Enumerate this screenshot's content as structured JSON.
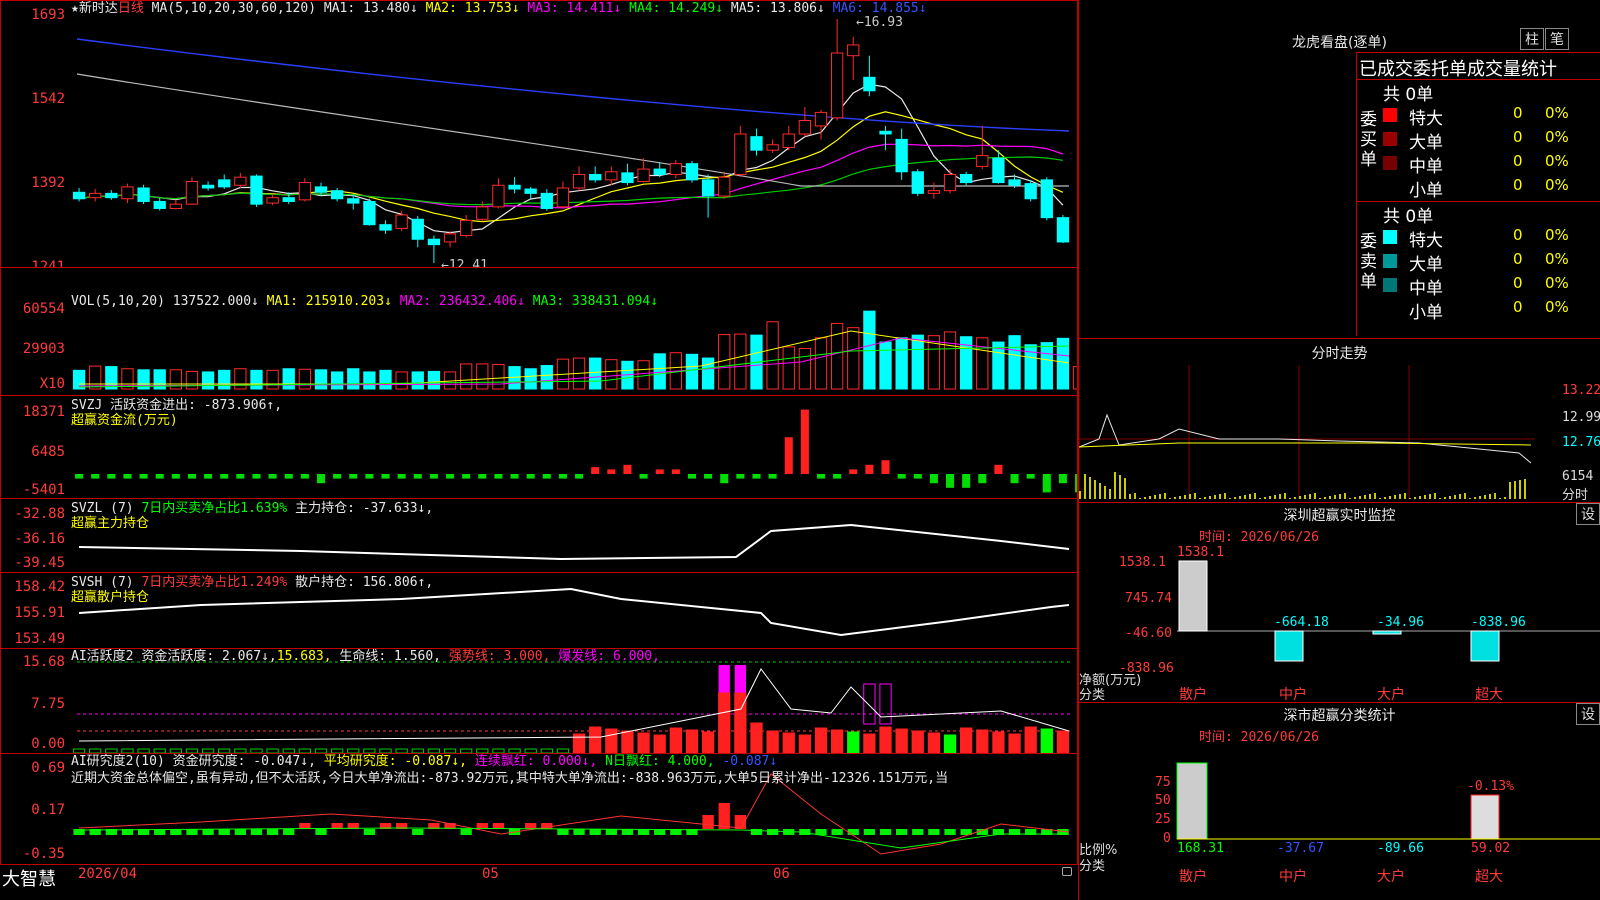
{
  "header": {
    "stock_name": "★新时达",
    "period": "日线",
    "ma_title": "MA(5,10,20,30,60,120)",
    "ma1": "MA1: 13.480↓",
    "ma2": "MA2: 13.753↓",
    "ma3": "MA3: 14.411↓",
    "ma4": "MA4: 14.249↓",
    "ma5": "MA5: 13.806↓",
    "ma6": "MA6: 14.855↓",
    "high_mark": "←16.93",
    "low_mark": "←12.41"
  },
  "price_axis": [
    "1693",
    "1542",
    "1392",
    "1241"
  ],
  "vol": {
    "title": "VOL(5,10,20)",
    "value": "137522.000↓",
    "ma1": "MA1: 215910.203↓",
    "ma2": "MA2: 236432.406↓",
    "ma3": "MA3: 338431.094↓",
    "axis": [
      "60554",
      "29903",
      "X10"
    ]
  },
  "svzj": {
    "line1_a": "SVZJ  活跃资金进出: ",
    "line1_b": "-873.906↑,",
    "line2": "超赢资金流(万元)",
    "axis": [
      "18371",
      "6485",
      "-5401"
    ]
  },
  "svzl": {
    "line1_a": "SVZL (7) ",
    "line1_b": "7日内买卖净占比1.639%",
    "line1_c": " 主力持仓: -37.633↓,",
    "line2": "超赢主力持仓",
    "axis": [
      "-32.88",
      "-36.16",
      "-39.45"
    ]
  },
  "svsh": {
    "line1_a": "SVSH (7) ",
    "line1_b": "7日内买卖净占比1.249%",
    "line1_c": " 散户持仓: 156.806↑,",
    "line2": "超赢散户持仓",
    "axis": [
      "158.42",
      "155.91",
      "153.49"
    ]
  },
  "ai": {
    "a": "AI活跃度2 ",
    "b": "资金活跃度: 2.067↓,",
    "c": "15.683,",
    "d": "生命线: 1.560,",
    "e": "强势线: 3.000,",
    "f": "爆发线: 6.000,",
    "axis": [
      "15.68",
      "7.75",
      "0.00"
    ]
  },
  "ai2": {
    "a": "AI研究度2(10) ",
    "b": "资金研究度: -0.047↓,",
    "c": "平均研究度: -0.087↓,",
    "d": "连续飘红: 0.000↓,",
    "e": "N日飘红: 4.000,",
    "f": "-0.087↓",
    "text": "近期大资金总体偏空,虽有异动,但不太活跃,今日大单净流出:-873.92万元,其中特大单净流出:-838.963万元,大单5日累计净出-12326.151万元,当",
    "axis": [
      "0.69",
      "0.17",
      "-0.35"
    ]
  },
  "date_axis": [
    "2026/04",
    "05",
    "06"
  ],
  "brand": "大智慧",
  "right": {
    "lhb_title": "龙虎看盘(逐单)",
    "btn_a": "柱",
    "btn_b": "笔",
    "tab_title": "已成交委托单成交量统计",
    "buy": {
      "label": "委买单",
      "total": "共 0单",
      "rows": [
        {
          "name": "特大",
          "v": "0",
          "p": "0%",
          "color": "#ff0000"
        },
        {
          "name": "大单",
          "v": "0",
          "p": "0%",
          "color": "#990000"
        },
        {
          "name": "中单",
          "v": "0",
          "p": "0%",
          "color": "#770000"
        },
        {
          "name": "小单",
          "v": "0",
          "p": "0%",
          "color": ""
        }
      ]
    },
    "sell": {
      "label": "委卖单",
      "total": "共 0单",
      "rows": [
        {
          "name": "特大",
          "v": "0",
          "p": "0%",
          "color": "#00ffff"
        },
        {
          "name": "大单",
          "v": "0",
          "p": "0%",
          "color": "#009999"
        },
        {
          "name": "中单",
          "v": "0",
          "p": "0%",
          "color": "#007777"
        },
        {
          "name": "小单",
          "v": "0",
          "p": "0%",
          "color": ""
        }
      ]
    },
    "fs_title": "分时走势",
    "fs_axis": [
      "13.22",
      "12.99",
      "12.76"
    ],
    "fs_vol": "6154",
    "fs_vol2": "分时",
    "sz_title": "深圳超赢实时监控",
    "sz_btn": "设",
    "sz_time": "时间: 2026/06/26",
    "sz_axis": [
      "1538.1",
      "745.74",
      "-46.60",
      "-838.96"
    ],
    "sz_ylabel": "净额(万元)",
    "sz_xlabel": "分类",
    "sz_top": "1538.1",
    "sz_vals": [
      "-664.18",
      "-34.96",
      "-838.96"
    ],
    "sz_cats": [
      "散户",
      "中户",
      "大户",
      "超大"
    ],
    "fl_title": "深市超赢分类统计",
    "fl_btn": "设",
    "fl_time": "时间: 2026/06/26",
    "fl_axis": [
      "75",
      "50",
      "25",
      "0"
    ],
    "fl_ylabel": "比例%",
    "fl_xlabel": "分类",
    "fl_vals": [
      "168.31",
      "-37.67",
      "-89.66",
      "59.02"
    ],
    "fl_pct": "-0.13%",
    "fl_cats": [
      "散户",
      "中户",
      "大户",
      "超大"
    ]
  },
  "chart_data": {
    "type": "candlestick",
    "ylim": [
      12.41,
      16.93
    ],
    "candles": [
      [
        13.72,
        13.6,
        13.8,
        13.55
      ],
      [
        13.62,
        13.7,
        13.78,
        13.55
      ],
      [
        13.7,
        13.62,
        13.76,
        13.58
      ],
      [
        13.6,
        13.82,
        13.88,
        13.52
      ],
      [
        13.8,
        13.55,
        13.86,
        13.5
      ],
      [
        13.55,
        13.42,
        13.62,
        13.38
      ],
      [
        13.42,
        13.5,
        13.58,
        13.4
      ],
      [
        13.5,
        13.92,
        14.0,
        13.48
      ],
      [
        13.85,
        13.8,
        13.92,
        13.75
      ],
      [
        13.95,
        13.82,
        14.05,
        13.78
      ],
      [
        13.85,
        14.0,
        14.08,
        13.8
      ],
      [
        14.02,
        13.5,
        14.05,
        13.45
      ],
      [
        13.52,
        13.62,
        13.7,
        13.48
      ],
      [
        13.62,
        13.55,
        13.72,
        13.5
      ],
      [
        13.58,
        13.9,
        13.98,
        13.55
      ],
      [
        13.82,
        13.72,
        13.9,
        13.65
      ],
      [
        13.75,
        13.6,
        13.8,
        13.55
      ],
      [
        13.6,
        13.52,
        13.68,
        13.4
      ],
      [
        13.55,
        13.12,
        13.6,
        13.1
      ],
      [
        13.12,
        13.02,
        13.2,
        12.95
      ],
      [
        13.05,
        13.3,
        13.38,
        13.0
      ],
      [
        13.22,
        12.85,
        13.28,
        12.7
      ],
      [
        12.85,
        12.75,
        12.92,
        12.41
      ],
      [
        12.8,
        12.95,
        13.0,
        12.7
      ],
      [
        12.92,
        13.2,
        13.3,
        12.88
      ],
      [
        13.22,
        13.45,
        13.55,
        13.18
      ],
      [
        13.45,
        13.85,
        13.98,
        13.42
      ],
      [
        13.85,
        13.78,
        14.0,
        13.7
      ],
      [
        13.78,
        13.7,
        13.82,
        13.6
      ],
      [
        13.7,
        13.42,
        13.78,
        13.38
      ],
      [
        13.45,
        13.8,
        13.92,
        13.42
      ],
      [
        13.8,
        14.05,
        14.2,
        13.75
      ],
      [
        14.05,
        13.95,
        14.2,
        13.9
      ],
      [
        13.95,
        14.1,
        14.2,
        13.85
      ],
      [
        14.08,
        13.9,
        14.25,
        13.85
      ],
      [
        13.92,
        14.15,
        14.35,
        13.9
      ],
      [
        14.15,
        14.05,
        14.28,
        14.0
      ],
      [
        14.05,
        14.25,
        14.32,
        13.98
      ],
      [
        14.25,
        13.95,
        14.3,
        13.9
      ],
      [
        13.95,
        13.65,
        14.05,
        13.25
      ],
      [
        13.65,
        14.0,
        14.1,
        13.6
      ],
      [
        14.05,
        14.8,
        14.95,
        14.0
      ],
      [
        14.75,
        14.5,
        14.9,
        14.4
      ],
      [
        14.5,
        14.6,
        14.7,
        14.45
      ],
      [
        14.55,
        14.8,
        14.95,
        14.5
      ],
      [
        14.8,
        15.05,
        15.3,
        14.75
      ],
      [
        14.95,
        15.2,
        15.25,
        14.7
      ],
      [
        15.1,
        16.3,
        16.93,
        15.05
      ],
      [
        16.25,
        16.45,
        16.6,
        15.8
      ],
      [
        15.85,
        15.6,
        16.25,
        15.5
      ],
      [
        14.85,
        14.8,
        14.95,
        14.5
      ],
      [
        14.7,
        14.1,
        14.9,
        13.95
      ],
      [
        14.1,
        13.7,
        14.15,
        13.65
      ],
      [
        13.7,
        13.75,
        13.9,
        13.6
      ],
      [
        13.75,
        14.05,
        14.15,
        13.7
      ],
      [
        14.05,
        13.9,
        14.1,
        13.85
      ],
      [
        14.2,
        14.4,
        14.95,
        14.15
      ],
      [
        14.35,
        13.9,
        14.5,
        13.88
      ],
      [
        13.95,
        13.85,
        14.05,
        13.8
      ],
      [
        13.88,
        13.6,
        13.95,
        13.55
      ],
      [
        13.95,
        13.25,
        14.0,
        13.2
      ],
      [
        13.25,
        12.8,
        13.3,
        12.78
      ]
    ],
    "volumes": [
      3.5,
      4.3,
      4.2,
      3.8,
      3.6,
      3.6,
      3.6,
      3.3,
      3.2,
      3.5,
      3.8,
      3.5,
      3.5,
      3.8,
      3.7,
      3.6,
      3.2,
      3.8,
      3.2,
      3.5,
      3.2,
      3.2,
      3.3,
      3.2,
      4.7,
      4.7,
      4.6,
      4.2,
      3.8,
      4.4,
      5.6,
      5.8,
      5.8,
      5.5,
      5.2,
      5.3,
      6.6,
      6.8,
      6.5,
      5.8,
      10.2,
      10.3,
      10.1,
      12.6,
      7.9,
      7.6,
      9.6,
      12.3,
      11.5,
      14.6,
      8.8,
      9.6,
      10.1,
      10.0,
      10.7,
      9.8,
      9.6,
      8.8,
      10.0,
      8.3,
      8.7,
      9.5,
      4.2
    ],
    "svzj": [
      -1,
      -1,
      -1,
      -1,
      -1,
      -1,
      -1,
      -1,
      -1,
      -1,
      -1,
      -1,
      -1,
      -1,
      -1,
      -2,
      -1,
      -1,
      -1,
      -1,
      -1,
      -1,
      -1,
      -1,
      -1,
      -1,
      -1,
      -1,
      -1,
      -1,
      -1,
      -1,
      1.5,
      1,
      2,
      -1,
      1,
      1,
      -1,
      -1,
      -2,
      -1,
      -1,
      -1,
      8,
      14,
      -1,
      -1,
      1,
      2,
      3,
      -1,
      -1,
      -2,
      -3,
      -3,
      -2,
      2,
      -2,
      -1,
      -4,
      -2,
      -4,
      -1
    ]
  }
}
